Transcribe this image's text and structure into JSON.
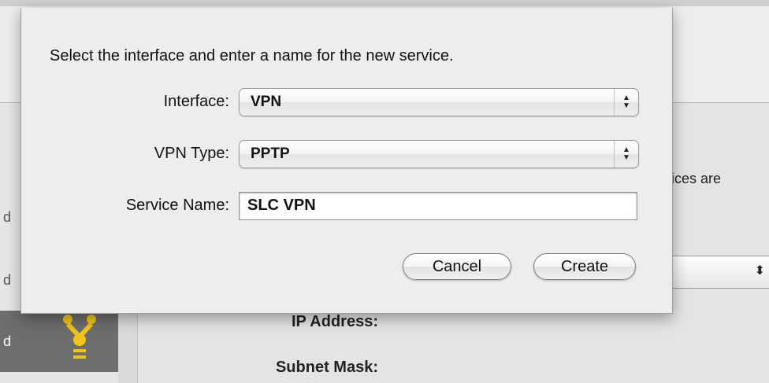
{
  "sheet": {
    "prompt": "Select the interface and enter a name for the new service.",
    "interface_label": "Interface:",
    "interface_value": "VPN",
    "vpn_type_label": "VPN Type:",
    "vpn_type_value": "PPTP",
    "service_name_label": "Service Name:",
    "service_name_value": "SLC VPN",
    "cancel_label": "Cancel",
    "create_label": "Create"
  },
  "background": {
    "sidebar_items": [
      "d",
      "d",
      "d"
    ],
    "status_description_fragment": "ices are",
    "ip_address_label": "IP Address:",
    "subnet_mask_label": "Subnet Mask:",
    "configure_arrows": "⬍"
  },
  "icons": {
    "popup_arrows": "stepper-arrows-icon",
    "firewire": "firewire-icon"
  },
  "colors": {
    "sidebar_selected": "#6d6d6d",
    "firewire_yellow": "#f0c419"
  }
}
